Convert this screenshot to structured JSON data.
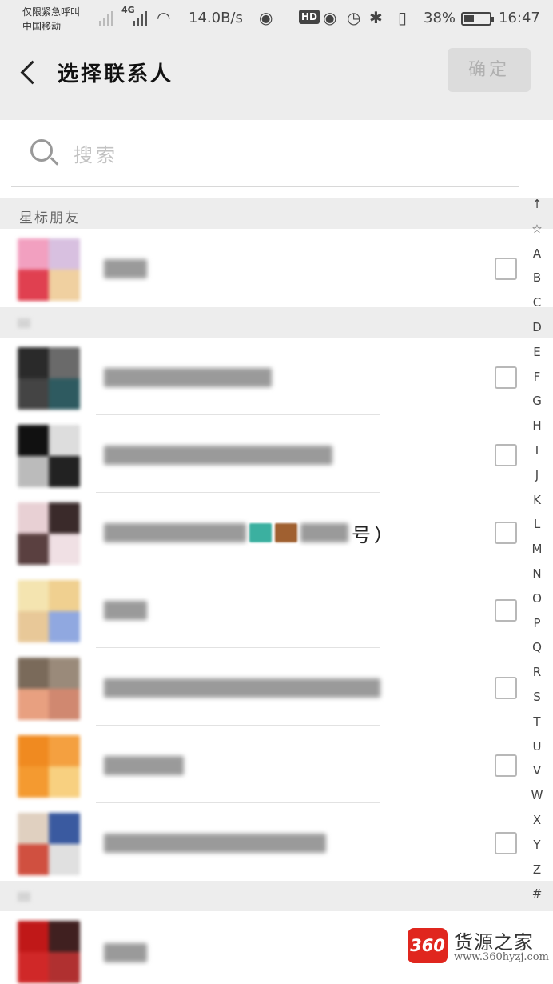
{
  "status_bar": {
    "carrier_line1": "仅限紧急呼叫",
    "carrier_line2": "中国移动",
    "network_type": "4G",
    "speed": "14.0B/s",
    "hd": "HD",
    "battery_percent": "38%",
    "time": "16:47"
  },
  "header": {
    "title": "选择联系人",
    "confirm_label": "确定"
  },
  "search": {
    "placeholder": "搜索",
    "value": ""
  },
  "sections": [
    {
      "label": "星标朋友"
    },
    {
      "label": ""
    },
    {
      "label": ""
    }
  ],
  "contacts": [
    {
      "name_visible": "",
      "selected": false
    },
    {
      "name_visible": "",
      "selected": false
    },
    {
      "name_visible": "",
      "selected": false
    },
    {
      "name_visible": "号）",
      "selected": false
    },
    {
      "name_visible": "",
      "selected": false
    },
    {
      "name_visible": "",
      "selected": false
    },
    {
      "name_visible": "",
      "selected": false
    },
    {
      "name_visible": "",
      "selected": false
    },
    {
      "name_visible": "",
      "selected": false
    }
  ],
  "index_bar": [
    "↑",
    "☆",
    "A",
    "B",
    "C",
    "D",
    "E",
    "F",
    "G",
    "H",
    "I",
    "J",
    "K",
    "L",
    "M",
    "N",
    "O",
    "P",
    "Q",
    "R",
    "S",
    "T",
    "U",
    "V",
    "W",
    "X",
    "Y",
    "Z",
    "#"
  ],
  "watermark": {
    "badge": "360",
    "title": "货源之家",
    "url": "www.360hyzj.com"
  },
  "colors": {
    "header_bg": "#ededed",
    "confirm_disabled_bg": "#dcdcdc",
    "brand_red": "#e0261e"
  }
}
